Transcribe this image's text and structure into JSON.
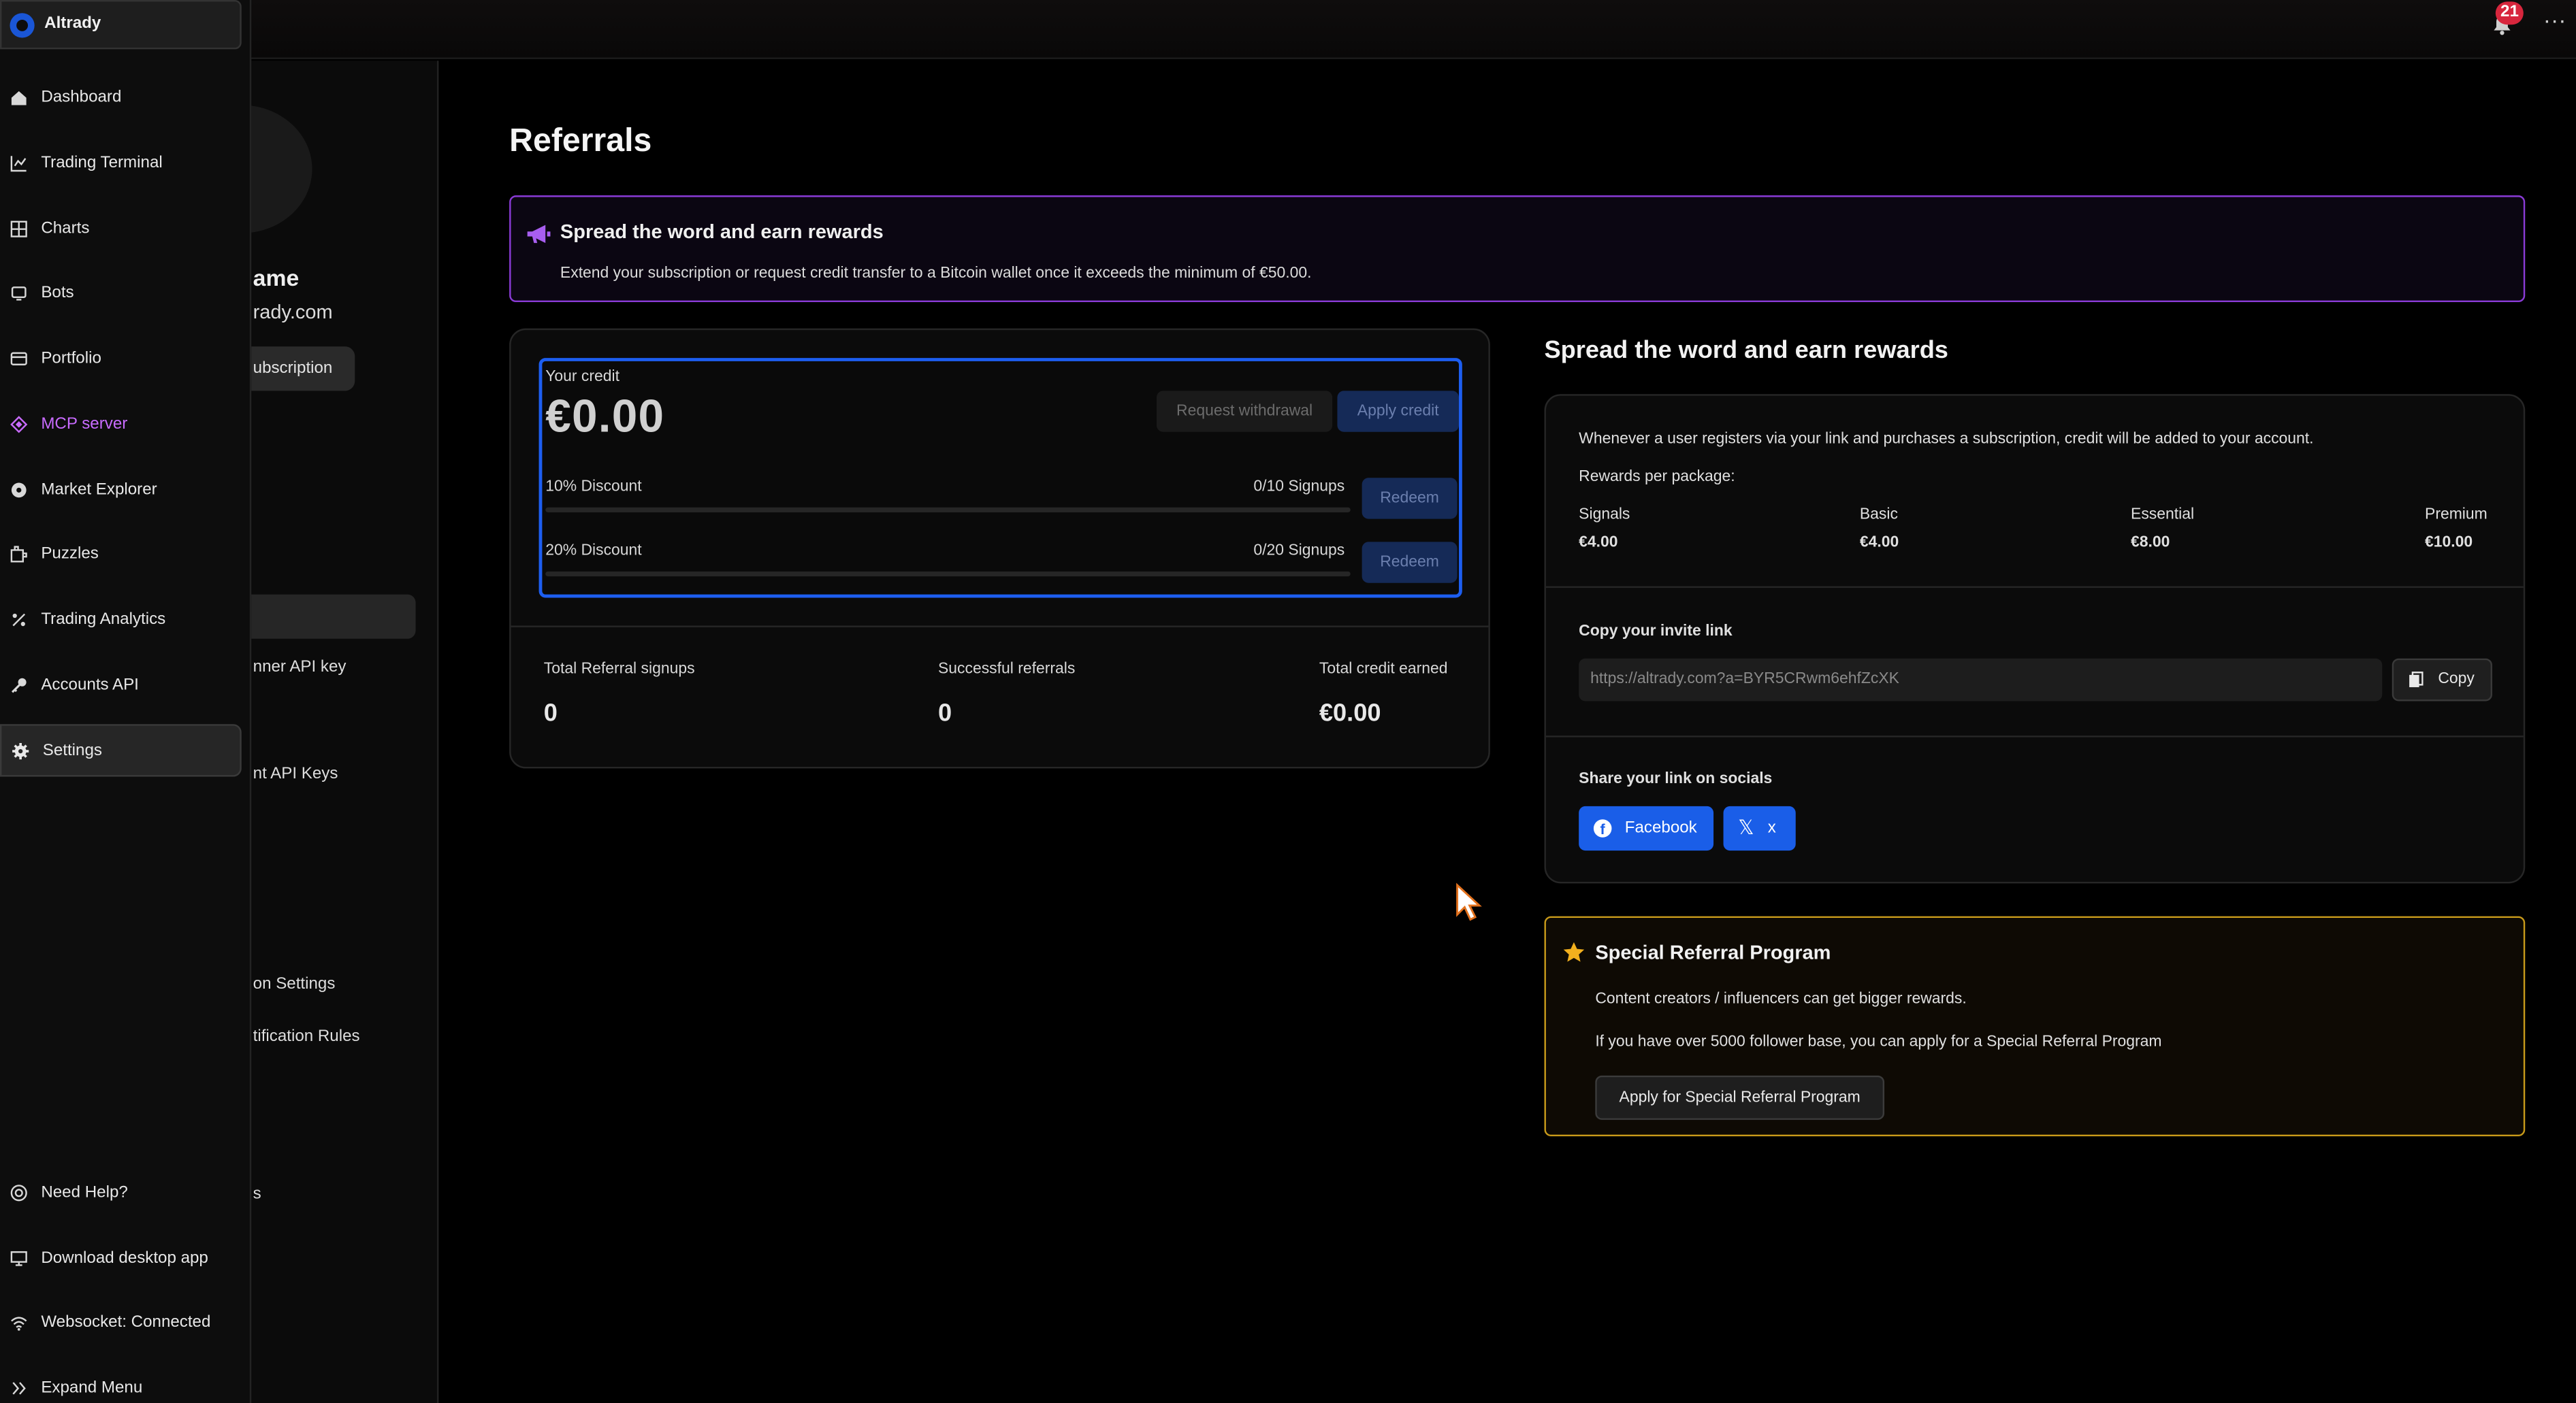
{
  "topbar": {
    "notification_count": "21",
    "more_label": "···"
  },
  "sidebar": {
    "brand": "Altrady",
    "items": [
      {
        "label": "Dashboard",
        "icon": "home-icon"
      },
      {
        "label": "Trading Terminal",
        "icon": "chart-line-icon"
      },
      {
        "label": "Charts",
        "icon": "grid-icon"
      },
      {
        "label": "Bots",
        "icon": "bot-icon"
      },
      {
        "label": "Portfolio",
        "icon": "wallet-icon"
      },
      {
        "label": "MCP server",
        "icon": "mcp-icon"
      },
      {
        "label": "Market Explorer",
        "icon": "compass-icon"
      },
      {
        "label": "Puzzles",
        "icon": "puzzle-icon"
      },
      {
        "label": "Trading Analytics",
        "icon": "percent-icon"
      },
      {
        "label": "Accounts API",
        "icon": "key-icon"
      },
      {
        "label": "Settings",
        "icon": "gear-icon"
      }
    ],
    "bottom": [
      {
        "label": "Need Help?",
        "icon": "help-icon"
      },
      {
        "label": "Download desktop app",
        "icon": "monitor-icon"
      },
      {
        "label": "Websocket: Connected",
        "icon": "wifi-icon"
      },
      {
        "label": "Expand Menu",
        "icon": "expand-icon"
      }
    ]
  },
  "settings_panel": {
    "name_partial": "ame",
    "email_partial": "rady.com",
    "subscription_btn": "ubscription",
    "items": [
      "nner API key",
      "nt API Keys",
      "on Settings",
      "tification Rules",
      "s"
    ]
  },
  "main": {
    "title": "Referrals",
    "banner": {
      "title": "Spread the word and earn rewards",
      "text": "Extend your subscription or request credit transfer to a Bitcoin wallet once it exceeds the minimum of €50.00."
    },
    "credit": {
      "label": "Your credit",
      "amount": "€0.00",
      "withdraw_label": "Request withdrawal",
      "apply_label": "Apply credit",
      "discounts": [
        {
          "label": "10% Discount",
          "progress": "0/10 Signups",
          "fraction": 0,
          "redeem": "Redeem"
        },
        {
          "label": "20% Discount",
          "progress": "0/20 Signups",
          "fraction": 0,
          "redeem": "Redeem"
        }
      ]
    },
    "stats": [
      {
        "label": "Total Referral signups",
        "value": "0"
      },
      {
        "label": "Successful referrals",
        "value": "0"
      },
      {
        "label": "Total credit earned",
        "value": "€0.00"
      }
    ]
  },
  "rewards": {
    "title": "Spread the word and earn rewards",
    "intro": "Whenever a user registers via your link and purchases a subscription, credit will be added to your account.",
    "per_package_label": "Rewards per package:",
    "packages": [
      {
        "name": "Signals",
        "amount": "€4.00"
      },
      {
        "name": "Basic",
        "amount": "€4.00"
      },
      {
        "name": "Essential",
        "amount": "€8.00"
      },
      {
        "name": "Premium",
        "amount": "€10.00"
      }
    ],
    "invite_label": "Copy your invite link",
    "invite_link": "https://altrady.com?a=BYR5CRwm6ehfZcXK",
    "copy_label": "Copy",
    "share_label": "Share your link on socials",
    "facebook_label": "Facebook",
    "x_label": "x"
  },
  "special": {
    "title": "Special Referral Program",
    "line1": "Content creators / influencers can get bigger rewards.",
    "line2": "If you have over 5000 follower base, you can apply for a Special Referral Program",
    "button": "Apply for Special Referral Program"
  },
  "colors": {
    "accent_blue": "#1d5ef0",
    "banner_purple": "#8a3bd6",
    "mcp_purple": "#c86bff",
    "special_gold": "#c89a1a",
    "badge_red": "#d7263d"
  }
}
